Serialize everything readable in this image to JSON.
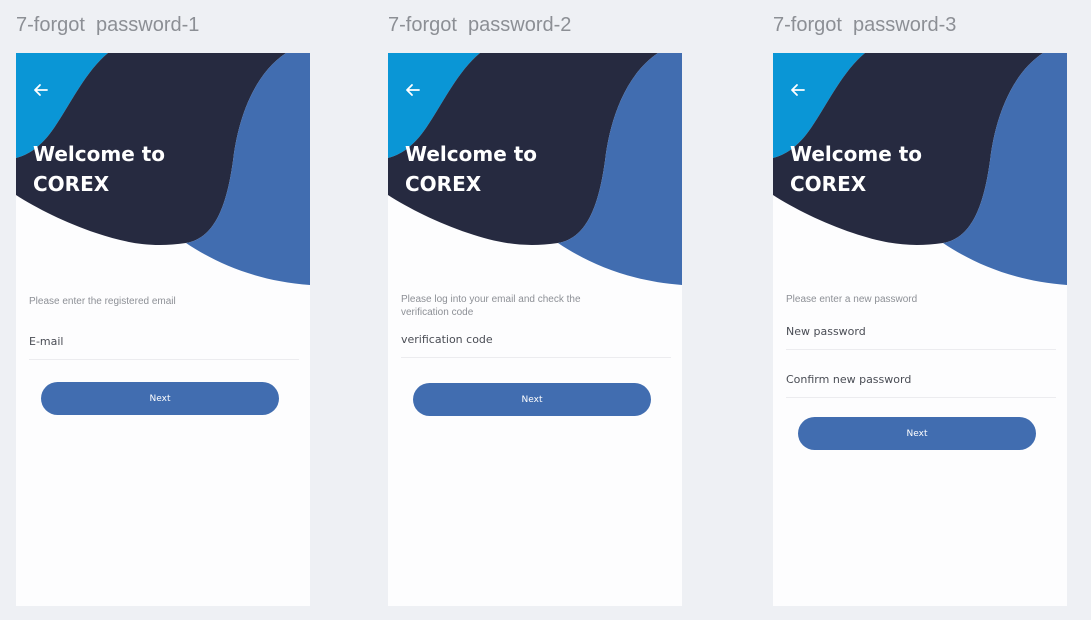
{
  "colors": {
    "light_blue": "#0a96d6",
    "navy": "#262a40",
    "blue": "#416db0",
    "page_bg": "#eef0f4"
  },
  "screens": [
    {
      "frame_title": "7-forgot  password-1",
      "back_icon": "arrow-left-icon",
      "welcome_line1": "Welcome to",
      "welcome_line2": "COREX",
      "prompt": "Please enter the registered email",
      "fields": [
        {
          "placeholder": "E-mail"
        }
      ],
      "button_label": "Next"
    },
    {
      "frame_title": "7-forgot  password-2",
      "back_icon": "arrow-left-icon",
      "welcome_line1": "Welcome to",
      "welcome_line2": "COREX",
      "prompt": "Please log into your email and check the verification code",
      "fields": [
        {
          "placeholder": "verification code"
        }
      ],
      "button_label": "Next"
    },
    {
      "frame_title": "7-forgot  password-3",
      "back_icon": "arrow-left-icon",
      "welcome_line1": "Welcome to",
      "welcome_line2": "COREX",
      "prompt": "Please enter a new password",
      "fields": [
        {
          "placeholder": "New password"
        },
        {
          "placeholder": "Confirm new password"
        }
      ],
      "button_label": "Next"
    }
  ]
}
